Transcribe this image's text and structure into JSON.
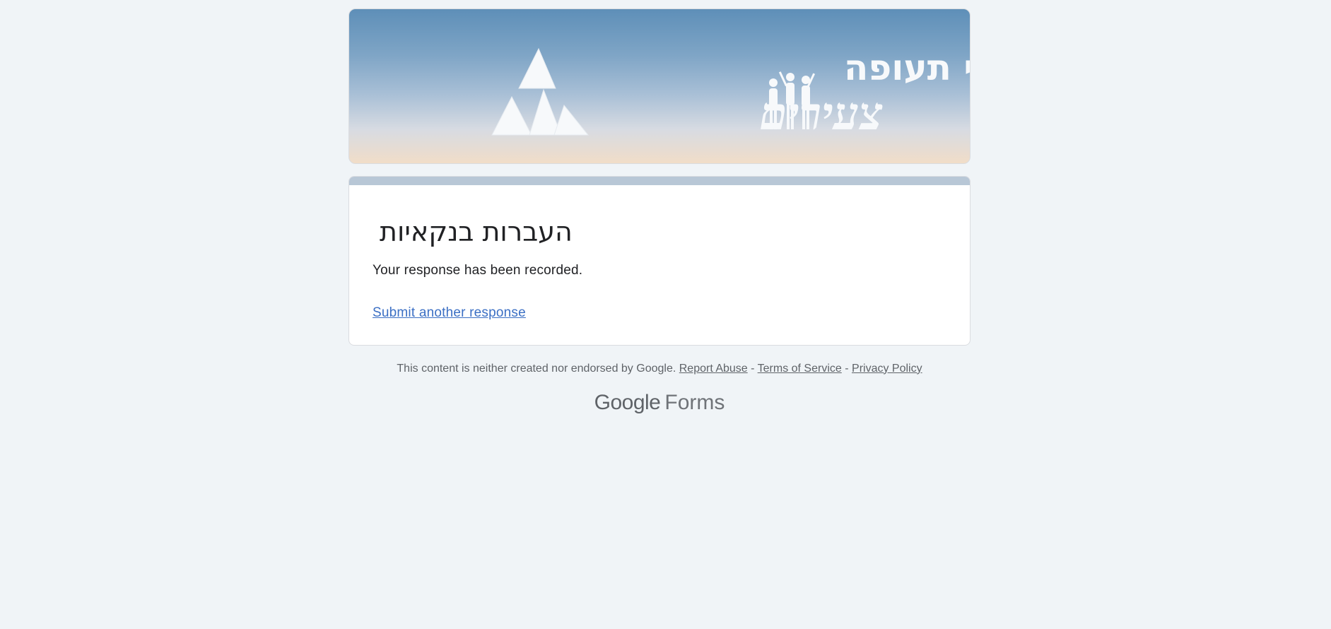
{
  "header": {
    "banner_title_line1": "קשרי תעופה",
    "banner_title_line2": "צעירים"
  },
  "form": {
    "title": "העברות בנקאיות",
    "confirmation": "Your response has been recorded.",
    "submit_another_label": "Submit another response"
  },
  "footer": {
    "disclaimer": "This content is neither created nor endorsed by Google.",
    "report_abuse": "Report Abuse",
    "separator": "-",
    "terms": "Terms of Service",
    "privacy": "Privacy Policy",
    "brand_google": "Google",
    "brand_forms": "Forms"
  },
  "colors": {
    "background": "#f0f4f7",
    "accent_bar": "#b8c7d6",
    "link": "#3b6fc4",
    "text": "#202124",
    "muted": "#5f6368"
  }
}
